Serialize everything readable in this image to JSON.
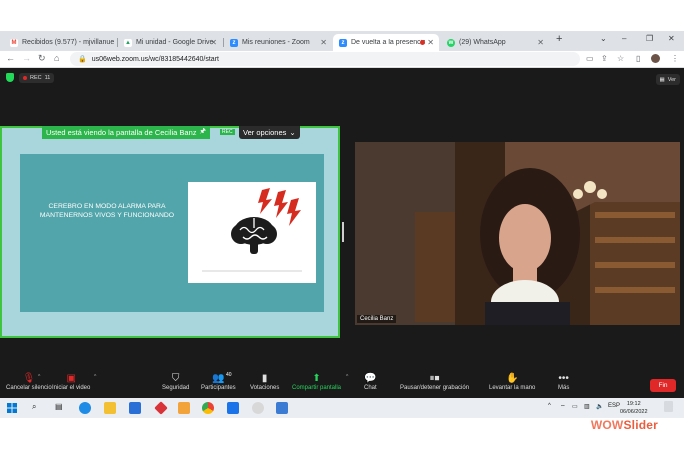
{
  "browser": {
    "tabs": [
      {
        "label": "Recibidos (9.577) - mjvillanue",
        "icon": "gmail-icon",
        "color": "#ea4335",
        "fav_text": "M"
      },
      {
        "label": "Mi unidad - Google Drive",
        "icon": "google-drive-icon",
        "color": "#1fa463",
        "fav_text": "▲"
      },
      {
        "label": "Mis reuniones - Zoom",
        "icon": "zoom-icon",
        "color": "#2d8cff",
        "fav_text": "z"
      },
      {
        "label": "De vuelta a la presencialidad",
        "icon": "zoom-icon",
        "color": "#2d8cff",
        "fav_text": "z",
        "active": true
      },
      {
        "label": "(29) WhatsApp",
        "icon": "whatsapp-icon",
        "color": "#25d366",
        "fav_text": "w"
      }
    ],
    "new_tab": "+",
    "window_controls": {
      "dropdown": "⌄",
      "minimize": "–",
      "restore": "❐",
      "close": "✕"
    },
    "url": "us06web.zoom.us/wc/83185442640/start"
  },
  "zoom": {
    "rec_label": "REC",
    "rec_count": "11",
    "ver_label": "Ver",
    "share_banner": "Usted está viendo la pantalla de Cecilia Banz",
    "rec_mini": "REC",
    "ver_opciones": "Ver opciones",
    "slide": {
      "title": "CEREBRO EN MODO ALARMA PARA MANTENERNOS VIVOS Y FUNCIONANDO"
    },
    "participant_name": "Cecilia Banz",
    "participants_count": "40",
    "toolbar": {
      "mute": "Cancelar silencio",
      "video": "Iniciar el video",
      "security": "Seguridad",
      "participants": "Participantes",
      "votes": "Votaciones",
      "share": "Compartir pantalla",
      "chat": "Chat",
      "record": "Pausar/detener grabación",
      "raise_hand": "Levantar la mano",
      "more": "Más",
      "end": "Fin"
    }
  },
  "taskbar": {
    "lang": "ESP",
    "time": "19:12",
    "date": "06/06/2022"
  },
  "watermark": {
    "text_a": "WOW",
    "text_b": "Slider"
  },
  "colors": {
    "zoom_green": "#27d35b",
    "end_red": "#e02828",
    "slide_teal": "#52a5aa"
  }
}
